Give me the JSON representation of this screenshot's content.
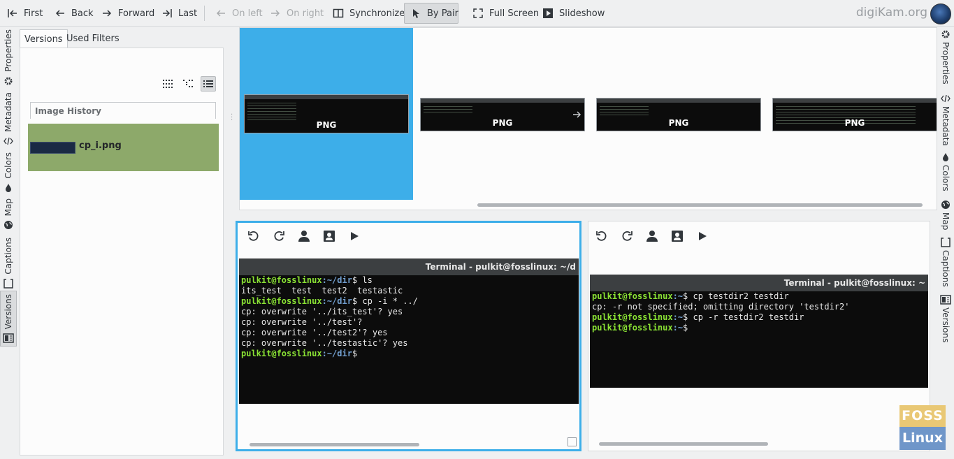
{
  "toolbar": {
    "first": "First",
    "back": "Back",
    "forward": "Forward",
    "last": "Last",
    "on_left": "On left",
    "on_right": "On right",
    "synchronize": "Synchronize",
    "by_pair": "By Pair",
    "full_screen": "Full Screen",
    "slideshow": "Slideshow",
    "brand": "digiKam.org"
  },
  "left_sidebar": {
    "tabs": [
      "Properties",
      "Metadata",
      "Colors",
      "Map",
      "Captions",
      "Versions"
    ],
    "selected": "Versions"
  },
  "right_sidebar": {
    "tabs": [
      "Properties",
      "Metadata",
      "Colors",
      "Map",
      "Captions",
      "Versions"
    ]
  },
  "versions_panel": {
    "tabs": [
      "Versions",
      "Used Filters"
    ],
    "history_header": "Image History",
    "items": [
      {
        "name": "cp_i.png"
      }
    ]
  },
  "filmstrip": {
    "items": [
      {
        "label": "PNG",
        "selected": true
      },
      {
        "label": "PNG",
        "selected": false
      },
      {
        "label": "PNG",
        "selected": false
      },
      {
        "label": "PNG",
        "selected": false
      }
    ]
  },
  "left_pane": {
    "terminal_title": "Terminal - pulkit@fosslinux: ~/d",
    "lines": [
      {
        "user": "pulkit@fosslinux",
        "path": ":~/dir",
        "cmd": "$ ls"
      },
      {
        "text": "its_test  test  test2  testastic"
      },
      {
        "user": "pulkit@fosslinux",
        "path": ":~/dir",
        "cmd": "$ cp -i * ../"
      },
      {
        "text": "cp: overwrite '../its_test'? yes"
      },
      {
        "text": "cp: overwrite '../test'?"
      },
      {
        "text": "cp: overwrite '../test2'? yes"
      },
      {
        "text": "cp: overwrite '../testastic'? yes"
      },
      {
        "user": "pulkit@fosslinux",
        "path": ":~/dir",
        "cmd": "$"
      }
    ]
  },
  "right_pane": {
    "terminal_title": "Terminal - pulkit@fosslinux: ~",
    "lines": [
      {
        "user": "pulkit@fosslinux",
        "path": ":~",
        "cmd": "$ cp testdir2 testdir"
      },
      {
        "text": "cp: -r not specified; omitting directory 'testdir2'"
      },
      {
        "user": "pulkit@fosslinux",
        "path": ":~",
        "cmd": "$ cp -r testdir2 testdir"
      },
      {
        "user": "pulkit@fosslinux",
        "path": ":~",
        "cmd": "$"
      }
    ]
  },
  "watermark": {
    "line1": "FOSS",
    "line2": "Linux"
  },
  "colors": {
    "accent": "#3daee9",
    "history_item": "#8da96a",
    "prompt_user": "#8ae234",
    "prompt_path": "#729fcf"
  }
}
